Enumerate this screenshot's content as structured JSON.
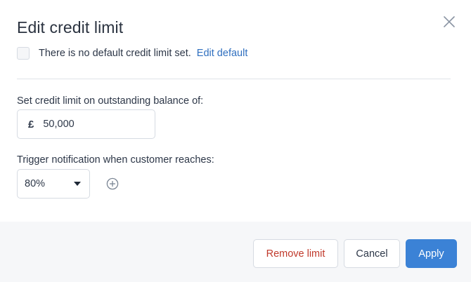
{
  "dialog": {
    "title": "Edit credit limit",
    "close_icon": "close-icon"
  },
  "default_limit": {
    "checked": false,
    "label": "There is no default credit limit set.",
    "link": "Edit default"
  },
  "credit_limit": {
    "label": "Set credit limit on outstanding balance of:",
    "currency_symbol": "£",
    "value": "50,000"
  },
  "notification": {
    "label": "Trigger notification when customer reaches:",
    "selected": "80%",
    "add_icon": "plus-circle-icon"
  },
  "footer": {
    "remove_label": "Remove limit",
    "cancel_label": "Cancel",
    "apply_label": "Apply"
  },
  "colors": {
    "accent": "#3b82d6",
    "link": "#2f6fbf",
    "danger": "#c0392b",
    "footer_bg": "#f6f7f9"
  }
}
